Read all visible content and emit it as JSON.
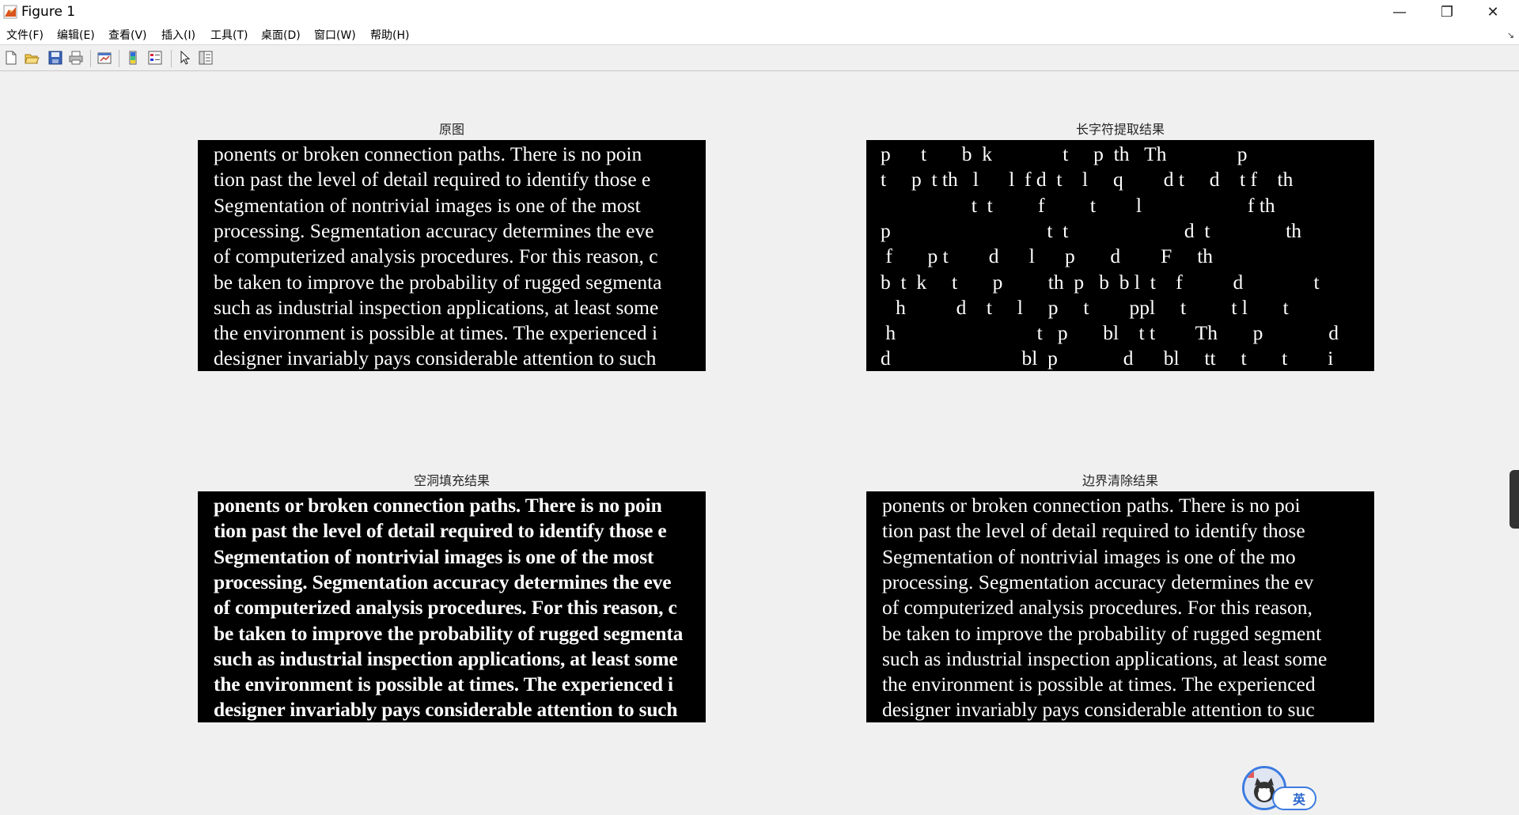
{
  "window": {
    "title": "Figure 1",
    "controls": {
      "minimize": "—",
      "maximize": "❐",
      "close": "✕"
    }
  },
  "menu": {
    "items": [
      "文件(F)",
      "编辑(E)",
      "查看(V)",
      "插入(I)",
      "工具(T)",
      "桌面(D)",
      "窗口(W)",
      "帮助(H)"
    ],
    "corner_glyph": "↘"
  },
  "toolbar": {
    "tools": [
      "new-figure-icon",
      "open-file-icon",
      "save-icon",
      "print-icon",
      "link-plot-icon",
      "colorbar-icon",
      "legend-icon",
      "edit-plot-arrow-icon",
      "property-inspector-icon"
    ]
  },
  "subplots": [
    {
      "title": "原图",
      "style": "normal",
      "lines": [
        "ponents or broken connection paths. There is no poin",
        "tion past the level of detail required to identify those e",
        "    Segmentation of nontrivial images is one of the most",
        "processing. Segmentation accuracy determines the eve",
        "of computerized analysis procedures. For this reason, c",
        "be taken to improve the probability of rugged segmenta",
        "such as industrial inspection applications, at least some",
        "the environment is possible at times. The experienced i",
        "designer invariably pays considerable attention to such"
      ]
    },
    {
      "title": "长字符提取结果",
      "style": "sparse",
      "lines": [
        "p      t       b  k              t     p  th   Th              p",
        "t     p  t th   l      l  f d  t    l     q        d t     d    t f    th",
        "                  t  t         f         t        l                     f th",
        "p                               t  t                       d  t               th",
        " f       p t        d      l      p       d        F     th",
        "b  t  k     t       p         th  p   b  b l  t    f          d              t",
        "   h          d    t     l     p     t        ppl     t         t l       t",
        " h                            t   p       bl    t t        Th       p             d",
        "d                          bl  p             d      bl     tt     t       t        i"
      ]
    },
    {
      "title": "空洞填充结果",
      "style": "filled",
      "lines": [
        "ponents or broken connection paths. There is no poin",
        "tion past the level of detail required to identify those e",
        "    Segmentation of nontrivial images is one of the most",
        "processing. Segmentation accuracy determines the eve",
        "of computerized analysis procedures. For this reason, c",
        "be taken to improve the probability of rugged segmenta",
        "such as industrial inspection applications, at least some",
        "the environment is possible at times. The experienced i",
        "designer invariably pays considerable attention to such"
      ]
    },
    {
      "title": "边界清除结果",
      "style": "normal",
      "lines": [
        "ponents or broken connection paths. There is no poi",
        "tion past the level of detail required to identify those",
        "    Segmentation of nontrivial images is one of the mo",
        "processing. Segmentation accuracy determines the ev",
        "of computerized analysis procedures. For this reason,",
        "be taken to improve the probability of rugged segment",
        "such as industrial inspection applications, at least some",
        "the environment is possible at times. The experienced",
        "designer invariably pays considerable attention to suc"
      ]
    }
  ],
  "ime": {
    "label": "英"
  }
}
